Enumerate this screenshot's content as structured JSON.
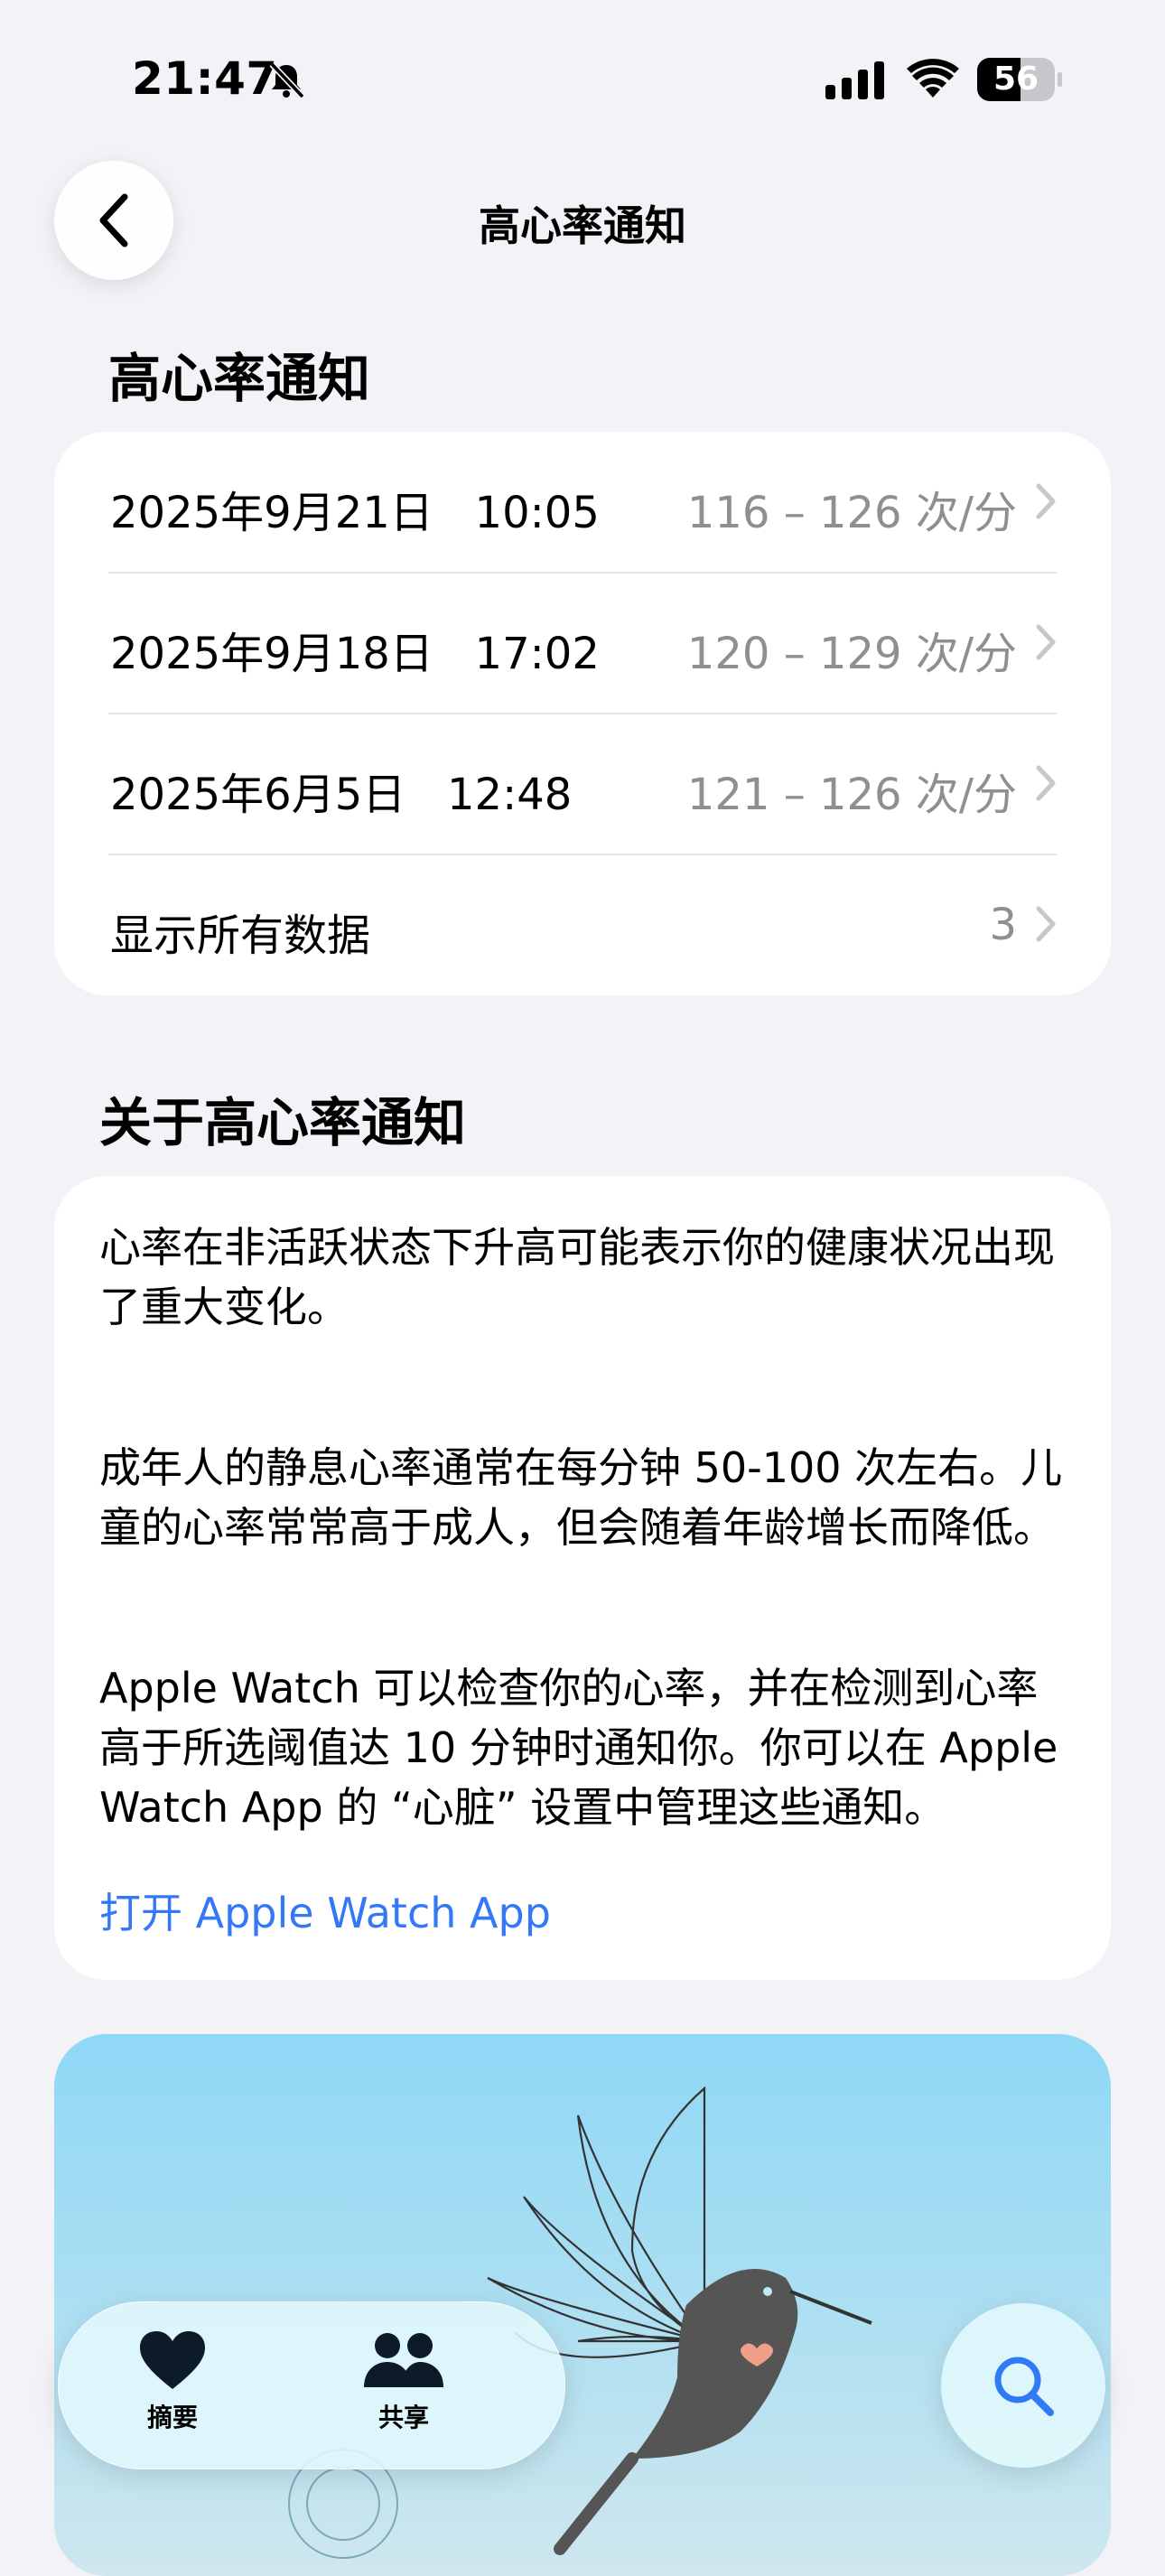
{
  "status_bar": {
    "time": "21:47",
    "battery_level": "56",
    "icons": [
      "bell-slash-icon",
      "cellular-signal-icon",
      "wifi-icon",
      "battery-icon"
    ]
  },
  "nav": {
    "back_icon": "chevron-left-icon",
    "title": "高心率通知"
  },
  "notifications_section": {
    "header": "高心率通知",
    "rows": [
      {
        "date": "2025年9月21日   10:05",
        "range": "116 – 126 次/分"
      },
      {
        "date": "2025年9月18日   17:02",
        "range": "120 – 129 次/分"
      },
      {
        "date": "2025年6月5日   12:48",
        "range": "121 – 126 次/分"
      }
    ],
    "show_all": {
      "label": "显示所有数据",
      "count": "3"
    }
  },
  "about_section": {
    "header": "关于高心率通知",
    "paragraphs": [
      "心率在非活跃状态下升高可能表示你的健康状况出现了重大变化。",
      "成年人的静息心率通常在每分钟 50-100 次左右。儿童的心率常常高于成人，但会随着年龄增长而降低。",
      "Apple Watch 可以检查你的心率，并在检测到心率高于所选阈值达 10 分钟时通知你。你可以在 Apple Watch App 的 “心脏” 设置中管理这些通知。"
    ],
    "link": "打开 Apple Watch App"
  },
  "tab_bar": {
    "tabs": [
      {
        "label": "摘要",
        "icon": "heart-icon"
      },
      {
        "label": "共享",
        "icon": "people-icon"
      }
    ],
    "search_icon": "search-icon"
  },
  "colors": {
    "background": "#f2f2f7",
    "card": "#ffffff",
    "secondary_text": "#8e8e93",
    "link": "#3478f6",
    "illustration_sky": "#8fd8f6"
  }
}
